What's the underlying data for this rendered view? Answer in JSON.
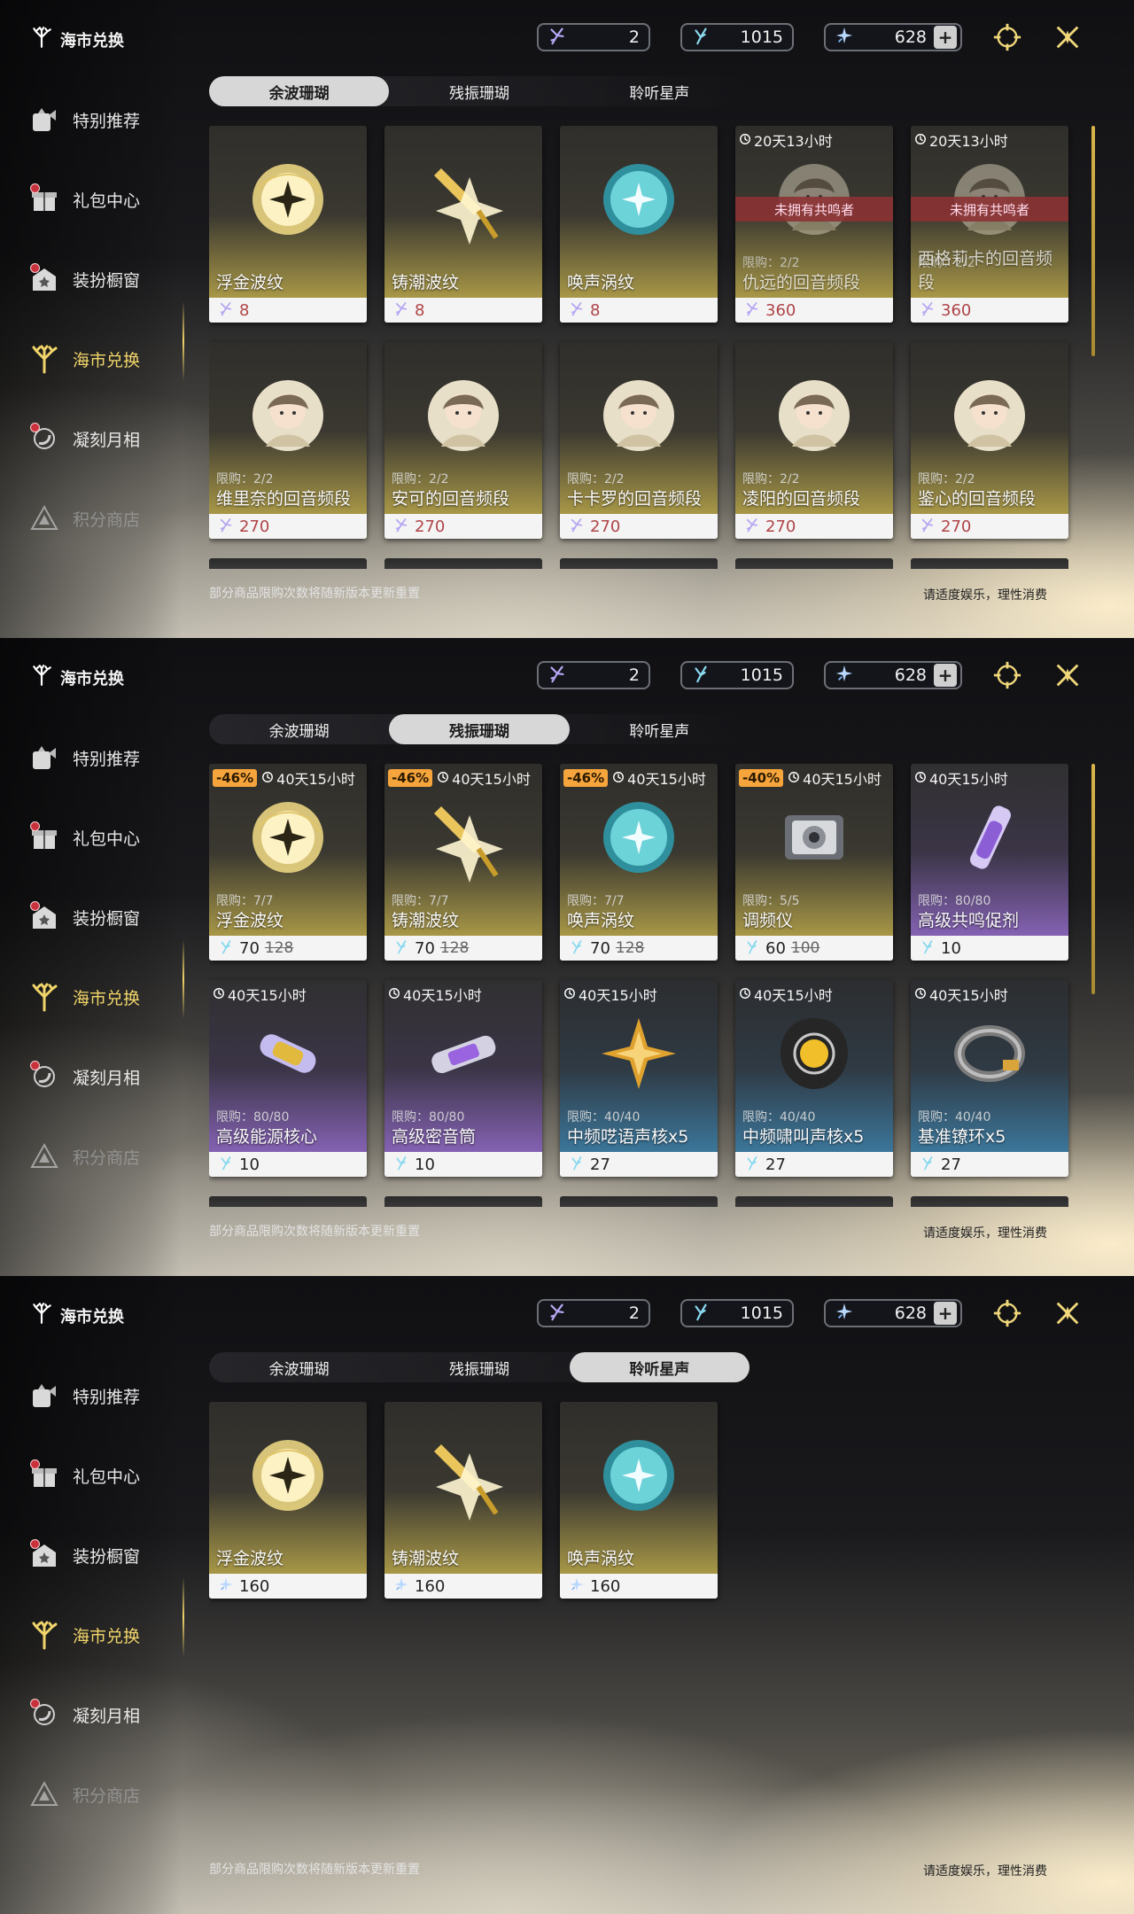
{
  "app_title": "海市兑换",
  "currencies": {
    "coral1": "2",
    "coral2": "1015",
    "star": "628",
    "plus": "+"
  },
  "sidebar": {
    "items": [
      {
        "label": "特别推荐",
        "icon": "recommend-icon"
      },
      {
        "label": "礼包中心",
        "icon": "gift-icon"
      },
      {
        "label": "装扮橱窗",
        "icon": "wardrobe-icon"
      },
      {
        "label": "海市兑换",
        "icon": "coral-icon"
      },
      {
        "label": "凝刻月相",
        "icon": "moon-icon"
      },
      {
        "label": "积分商店",
        "icon": "triangle-icon"
      }
    ]
  },
  "tabs": [
    "余波珊瑚",
    "残振珊瑚",
    "聆听星声"
  ],
  "footer": {
    "left": "部分商品限购次数将随新版本更新重置",
    "right": "请适度娱乐，理性消费"
  },
  "panel1": {
    "row1": [
      {
        "name": "浮金波纹",
        "price": "8"
      },
      {
        "name": "铸潮波纹",
        "price": "8"
      },
      {
        "name": "唤声涡纹",
        "price": "8"
      },
      {
        "name": "仇远的回音频段",
        "price": "360",
        "limit": "限购：2/2",
        "timer": "20天13小时",
        "status": "未拥有共鸣者"
      },
      {
        "name": "西格莉卡的回音频段",
        "price": "360",
        "limit": "限购：2/2",
        "timer": "20天13小时",
        "status": "未拥有共鸣者"
      }
    ],
    "row2": [
      {
        "name": "维里奈的回音频段",
        "price": "270",
        "limit": "限购：2/2"
      },
      {
        "name": "安可的回音频段",
        "price": "270",
        "limit": "限购：2/2"
      },
      {
        "name": "卡卡罗的回音频段",
        "price": "270",
        "limit": "限购：2/2"
      },
      {
        "name": "凌阳的回音频段",
        "price": "270",
        "limit": "限购：2/2"
      },
      {
        "name": "鉴心的回音频段",
        "price": "270",
        "limit": "限购：2/2"
      }
    ]
  },
  "panel2": {
    "row1": [
      {
        "name": "浮金波纹",
        "price": "70",
        "old": "128",
        "limit": "限购：7/7",
        "timer": "40天15小时",
        "discount": "-46%"
      },
      {
        "name": "铸潮波纹",
        "price": "70",
        "old": "128",
        "limit": "限购：7/7",
        "timer": "40天15小时",
        "discount": "-46%"
      },
      {
        "name": "唤声涡纹",
        "price": "70",
        "old": "128",
        "limit": "限购：7/7",
        "timer": "40天15小时",
        "discount": "-46%"
      },
      {
        "name": "调频仪",
        "price": "60",
        "old": "100",
        "limit": "限购：5/5",
        "timer": "40天15小时",
        "discount": "-40%"
      },
      {
        "name": "高级共鸣促剂",
        "price": "10",
        "limit": "限购：80/80",
        "timer": "40天15小时"
      }
    ],
    "row2": [
      {
        "name": "高级能源核心",
        "price": "10",
        "limit": "限购：80/80",
        "timer": "40天15小时"
      },
      {
        "name": "高级密音筒",
        "price": "10",
        "limit": "限购：80/80",
        "timer": "40天15小时"
      },
      {
        "name": "中频呓语声核x5",
        "price": "27",
        "limit": "限购：40/40",
        "timer": "40天15小时"
      },
      {
        "name": "中频啸叫声核x5",
        "price": "27",
        "limit": "限购：40/40",
        "timer": "40天15小时"
      },
      {
        "name": "基准镣环x5",
        "price": "27",
        "limit": "限购：40/40",
        "timer": "40天15小时"
      }
    ]
  },
  "panel3": {
    "row1": [
      {
        "name": "浮金波纹",
        "price": "160"
      },
      {
        "name": "铸潮波纹",
        "price": "160"
      },
      {
        "name": "唤声涡纹",
        "price": "160"
      }
    ]
  }
}
